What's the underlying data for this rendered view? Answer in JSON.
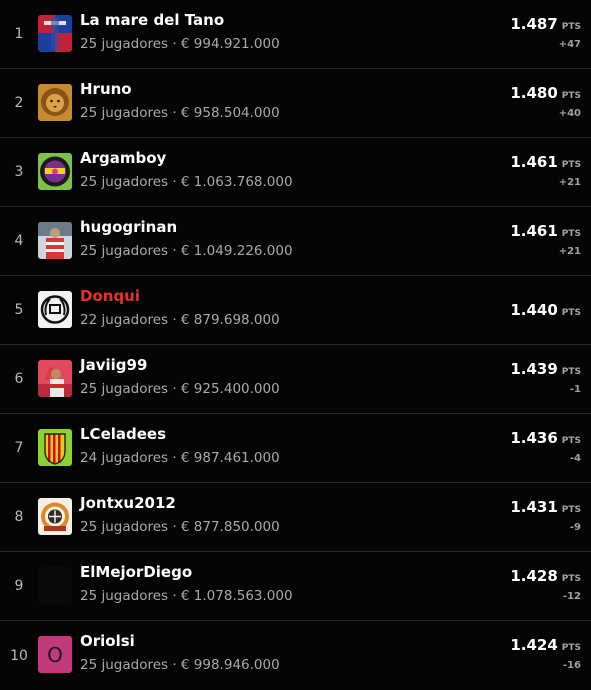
{
  "ranking": [
    {
      "rank": "1",
      "name": "La mare del Tano",
      "meta": "25 jugadores · € 994.921.000",
      "points": "1.487",
      "unit": "PTS",
      "delta": "+47",
      "avatar": "barca-crest-icon"
    },
    {
      "rank": "2",
      "name": "Hruno",
      "meta": "25 jugadores · € 958.504.000",
      "points": "1.480",
      "unit": "PTS",
      "delta": "+40",
      "avatar": "lion-photo-icon"
    },
    {
      "rank": "3",
      "name": "Argamboy",
      "meta": "25 jugadores · € 1.063.768.000",
      "points": "1.461",
      "unit": "PTS",
      "delta": "+21",
      "avatar": "round-badge-icon"
    },
    {
      "rank": "4",
      "name": "hugogrinan",
      "meta": "25 jugadores · € 1.049.226.000",
      "points": "1.461",
      "unit": "PTS",
      "delta": "+21",
      "avatar": "player-photo-icon"
    },
    {
      "rank": "5",
      "name": "Donqui",
      "meta": "22 jugadores · € 879.698.000",
      "points": "1.440",
      "unit": "PTS",
      "delta": "",
      "avatar": "laurel-emblem-icon",
      "highlight": true
    },
    {
      "rank": "6",
      "name": "Javiig99",
      "meta": "25 jugadores · € 925.400.000",
      "points": "1.439",
      "unit": "PTS",
      "delta": "-1",
      "avatar": "celebration-photo-icon"
    },
    {
      "rank": "7",
      "name": "LCeladees",
      "meta": "24 jugadores · € 987.461.000",
      "points": "1.436",
      "unit": "PTS",
      "delta": "-4",
      "avatar": "striped-shield-icon"
    },
    {
      "rank": "8",
      "name": "Jontxu2012",
      "meta": "25 jugadores · € 877.850.000",
      "points": "1.431",
      "unit": "PTS",
      "delta": "-9",
      "avatar": "club-crest-icon"
    },
    {
      "rank": "9",
      "name": "ElMejorDiego",
      "meta": "25 jugadores · € 1.078.563.000",
      "points": "1.428",
      "unit": "PTS",
      "delta": "-12",
      "avatar": "empty-avatar-icon"
    },
    {
      "rank": "10",
      "name": "Oriolsi",
      "meta": "25 jugadores · € 998.946.000",
      "points": "1.424",
      "unit": "PTS",
      "delta": "-16",
      "avatar": "letter-avatar-icon",
      "initial": "O"
    }
  ]
}
